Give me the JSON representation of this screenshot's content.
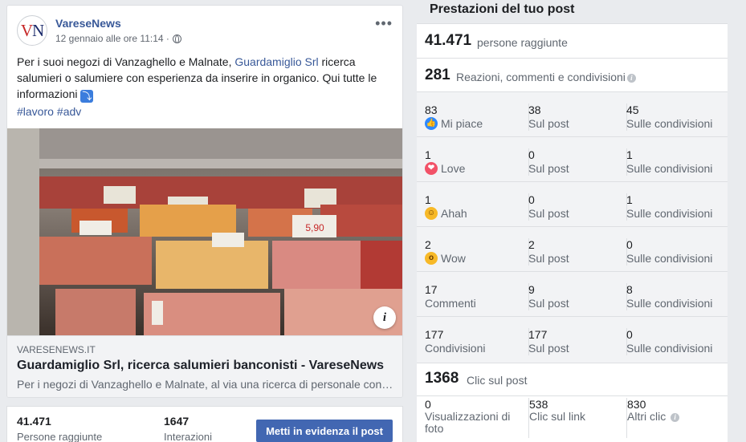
{
  "post": {
    "page_name": "VareseNews",
    "avatar_text_v": "V",
    "avatar_text_n": "N",
    "timestamp": "12 gennaio alle ore 11:14 ·",
    "text_before_link": "Per i suoi negozi di Vanzaghello e Malnate, ",
    "text_link": "Guardamiglio Srl",
    "text_after_link": " ricerca salumieri o salumiere con esperienza da inserire in organico. Qui tutte le informazioni ",
    "arrow_emoji": "⤵",
    "hashtags": [
      "#lavoro",
      "#adv"
    ],
    "preview": {
      "domain": "VARESENEWS.IT",
      "title": "Guardamiglio Srl, ricerca salumieri banconisti - VareseNews",
      "description": "Per i negozi di Vanzaghello e Malnate, al via una ricerca di personale con esperienza"
    },
    "stats": {
      "reach_value": "41.471",
      "reach_label": "Persone raggiunte",
      "interactions_value": "1647",
      "interactions_label": "Interazioni",
      "boost_label": "Metti in evidenza il post"
    }
  },
  "panel": {
    "title": "Prestazioni del tuo post",
    "reach": {
      "value": "41.471",
      "label": "persone raggiunte"
    },
    "engagement": {
      "value": "281",
      "label": "Reazioni, commenti e condivisioni"
    },
    "reactions": [
      {
        "value": "83",
        "label": "Mi piace",
        "icon": "like-icon",
        "color": "#2e89ff",
        "on_post": "38",
        "on_post_label": "Sul post",
        "on_shares": "45",
        "on_shares_label": "Sulle condivisioni"
      },
      {
        "value": "1",
        "label": "Love",
        "icon": "love-icon",
        "color": "#f25268",
        "on_post": "0",
        "on_post_label": "Sul post",
        "on_shares": "1",
        "on_shares_label": "Sulle condivisioni"
      },
      {
        "value": "1",
        "label": "Ahah",
        "icon": "haha-icon",
        "color": "#f7b928",
        "on_post": "0",
        "on_post_label": "Sul post",
        "on_shares": "1",
        "on_shares_label": "Sulle condivisioni"
      },
      {
        "value": "2",
        "label": "Wow",
        "icon": "wow-icon",
        "color": "#f7b928",
        "on_post": "2",
        "on_post_label": "Sul post",
        "on_shares": "0",
        "on_shares_label": "Sulle condivisioni"
      },
      {
        "value": "17",
        "label": "Commenti",
        "icon": "",
        "color": "",
        "on_post": "9",
        "on_post_label": "Sul post",
        "on_shares": "8",
        "on_shares_label": "Sulle condivisioni"
      },
      {
        "value": "177",
        "label": "Condivisioni",
        "icon": "",
        "color": "",
        "on_post": "177",
        "on_post_label": "Sul post",
        "on_shares": "0",
        "on_shares_label": "Sulle condivisioni"
      }
    ],
    "clicks": {
      "value": "1368",
      "label": "Clic sul post",
      "cols": [
        {
          "value": "0",
          "label": "Visualizzazioni di foto"
        },
        {
          "value": "538",
          "label": "Clic sul link"
        },
        {
          "value": "830",
          "label": "Altri clic"
        }
      ]
    }
  }
}
